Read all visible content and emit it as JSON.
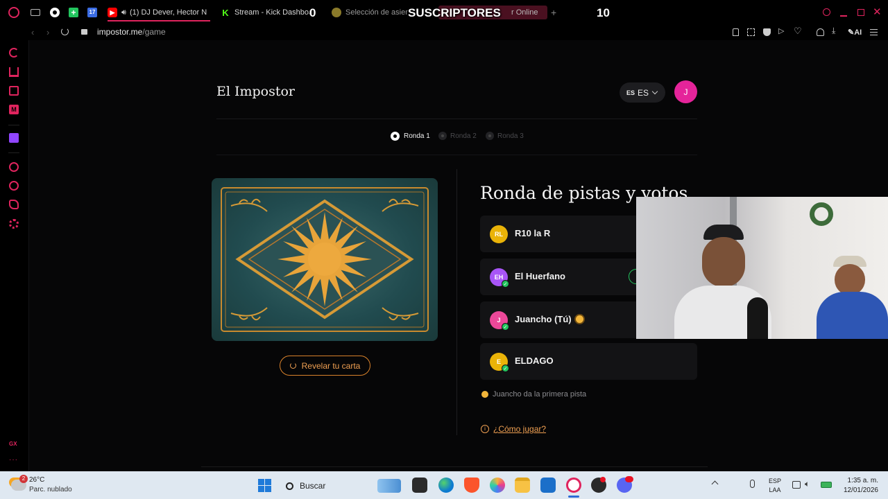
{
  "overlay": {
    "subs_count": "0",
    "subs_label": "SUSCRIPTORES",
    "right_count": "10"
  },
  "tabs": [
    {
      "label": "(1) DJ Dever, Hector N"
    },
    {
      "label": "Stream - Kick Dashboar"
    },
    {
      "label": "Selección de asient"
    },
    {
      "label": "r Online"
    }
  ],
  "address": {
    "domain": "impostor.me",
    "path": "/game"
  },
  "toolbar": {
    "ai_label": "AI"
  },
  "app": {
    "title": "El Impostor",
    "lang_flag": "ES",
    "lang_code": "ES",
    "user_initial": "J",
    "rounds": [
      "Ronda 1",
      "Ronda 2",
      "Ronda 3"
    ],
    "reveal_button": "Revelar tu carta",
    "section_title": "Ronda de pistas y votos",
    "players": [
      {
        "initials": "RL",
        "name": "R10 la R",
        "color": "#eab308",
        "checked": false,
        "turn": false
      },
      {
        "initials": "EH",
        "name": "El Huerfano",
        "color": "#a855f7",
        "checked": true,
        "turn": false
      },
      {
        "initials": "J",
        "name": "Juancho (Tú)",
        "color": "#ec4899",
        "checked": true,
        "turn": true
      },
      {
        "initials": "E",
        "name": "ELDAGO",
        "color": "#eab308",
        "checked": true,
        "turn": false
      }
    ],
    "first_clue": "Juancho da la primera pista",
    "how_to_play": "¿Cómo jugar?"
  },
  "taskbar": {
    "weather_temp": "26°C",
    "weather_desc": "Parc. nublado",
    "weather_badge": "2",
    "search_placeholder": "Buscar",
    "lang_top": "ESP",
    "lang_bottom": "LAA",
    "time": "1:35 a. m.",
    "date": "12/01/2026"
  },
  "colors": {
    "accent_orange": "#f59e0b",
    "brand_pink": "#ec4899",
    "opera_red": "#e0245e"
  }
}
